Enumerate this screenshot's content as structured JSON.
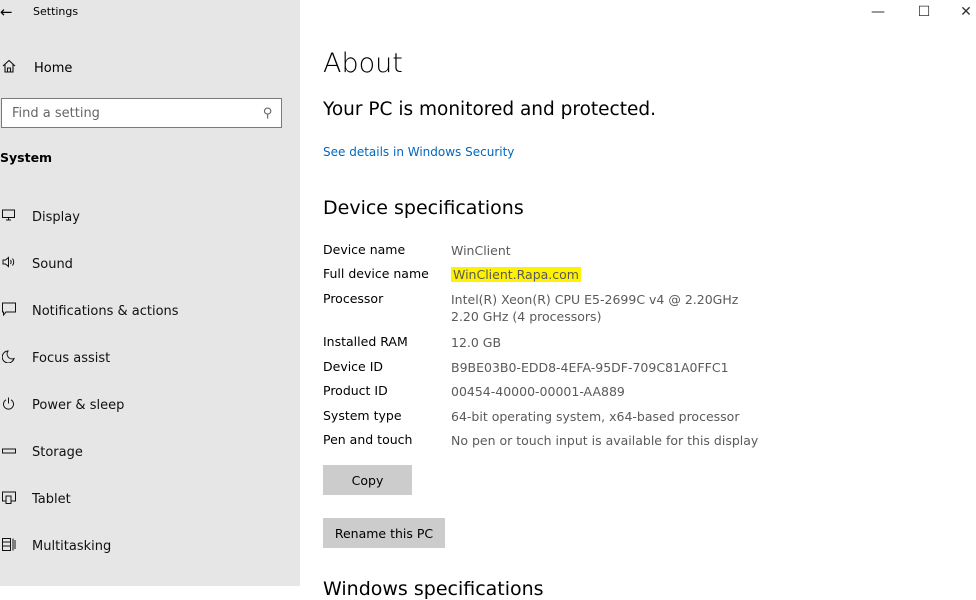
{
  "window": {
    "title": "Settings",
    "controls": {
      "minimize": "—",
      "maximize": "☐",
      "close": "✕"
    }
  },
  "sidebar": {
    "home_label": "Home",
    "search_placeholder": "Find a setting",
    "section_label": "System",
    "items": [
      {
        "label": "Display",
        "icon": "monitor-icon"
      },
      {
        "label": "Sound",
        "icon": "speaker-icon"
      },
      {
        "label": "Notifications & actions",
        "icon": "notification-icon"
      },
      {
        "label": "Focus assist",
        "icon": "moon-icon"
      },
      {
        "label": "Power & sleep",
        "icon": "power-icon"
      },
      {
        "label": "Storage",
        "icon": "storage-icon"
      },
      {
        "label": "Tablet",
        "icon": "tablet-icon"
      },
      {
        "label": "Multitasking",
        "icon": "multitasking-icon"
      }
    ]
  },
  "main": {
    "title": "About",
    "protection_status": "Your PC is monitored and protected.",
    "security_link": "See details in Windows Security",
    "specs_title": "Device specifications",
    "specs": [
      {
        "label": "Device name",
        "value": "WinClient"
      },
      {
        "label": "Full device name",
        "value": "WinClient.Rapa.com",
        "highlighted": true
      },
      {
        "label": "Processor",
        "value": "Intel(R) Xeon(R) CPU E5-2699C v4 @ 2.20GHz   2.20 GHz  (4 processors)"
      },
      {
        "label": "Installed RAM",
        "value": "12.0 GB"
      },
      {
        "label": "Device ID",
        "value": "B9BE03B0-EDD8-4EFA-95DF-709C81A0FFC1"
      },
      {
        "label": "Product ID",
        "value": "00454-40000-00001-AA889"
      },
      {
        "label": "System type",
        "value": "64-bit operating system, x64-based processor"
      },
      {
        "label": "Pen and touch",
        "value": "No pen or touch input is available for this display"
      }
    ],
    "copy_button": "Copy",
    "rename_button": "Rename this PC",
    "next_section_title": "Windows specifications"
  },
  "colors": {
    "sidebar_bg": "#e6e6e6",
    "link": "#0067c0",
    "highlight": "#fff200",
    "button_bg": "#cccccc"
  }
}
